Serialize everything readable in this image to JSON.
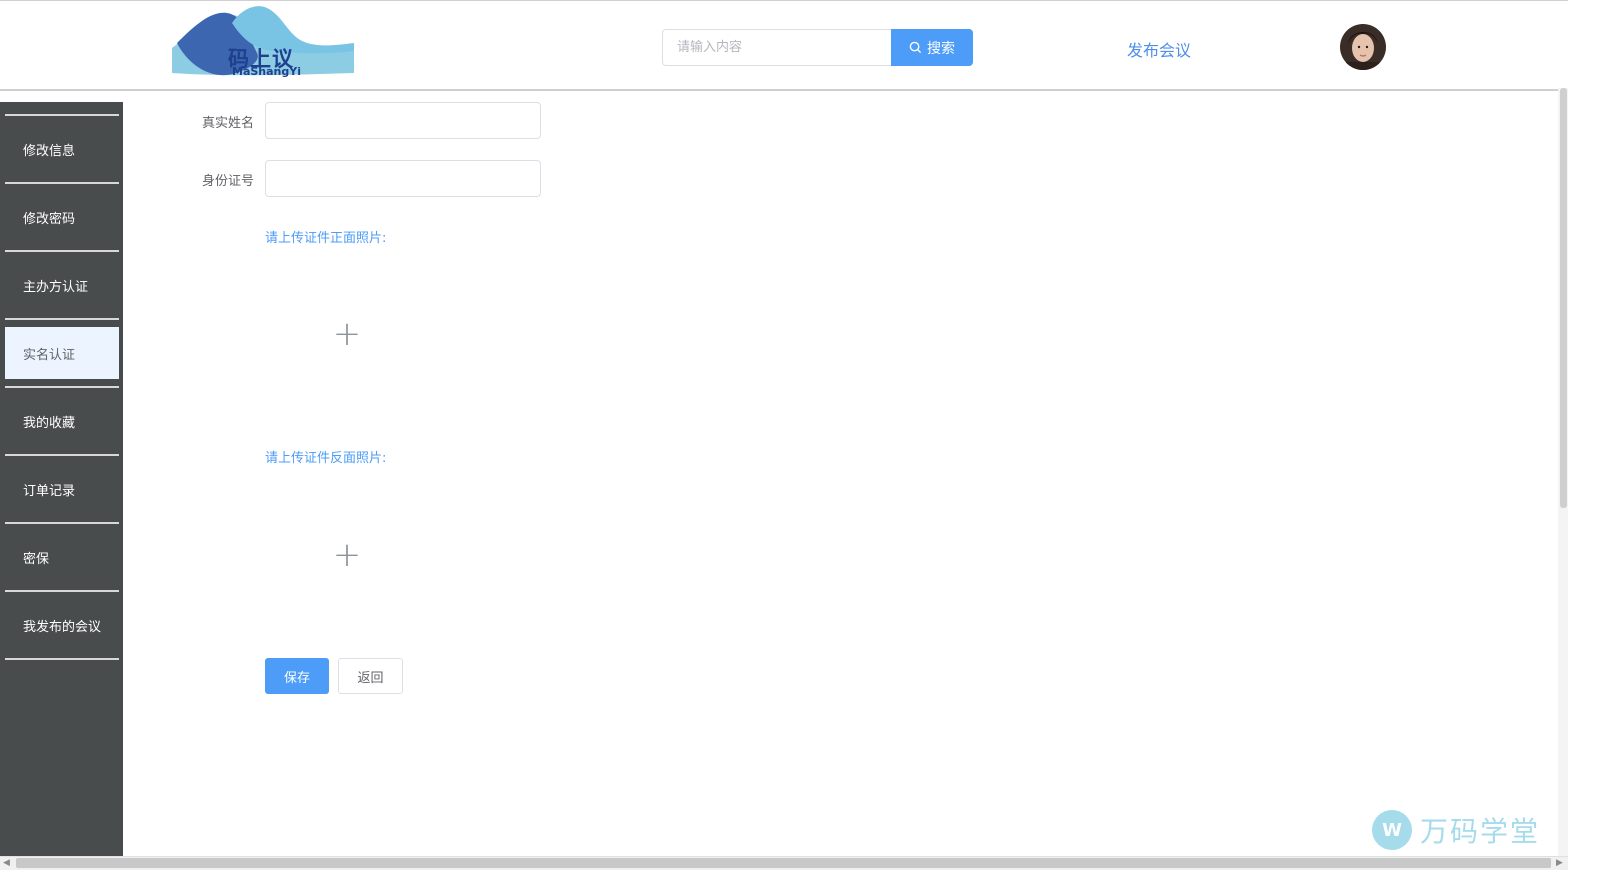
{
  "header": {
    "logo_text": "码上议",
    "logo_subtext": "MaShangYi",
    "search_placeholder": "请输入内容",
    "search_button_label": "搜索",
    "publish_link_label": "发布会议"
  },
  "sidebar": {
    "items": [
      {
        "label": "修改信息",
        "active": false
      },
      {
        "label": "修改密码",
        "active": false
      },
      {
        "label": "主办方认证",
        "active": false
      },
      {
        "label": "实名认证",
        "active": true
      },
      {
        "label": "我的收藏",
        "active": false
      },
      {
        "label": "订单记录",
        "active": false
      },
      {
        "label": "密保",
        "active": false
      },
      {
        "label": "我发布的会议",
        "active": false
      }
    ]
  },
  "form": {
    "real_name_label": "真实姓名",
    "real_name_value": "",
    "id_number_label": "身份证号",
    "id_number_value": "",
    "front_upload_label": "请上传证件正面照片:",
    "back_upload_label": "请上传证件反面照片:",
    "save_label": "保存",
    "back_label": "返回"
  },
  "watermark": {
    "text": "万码学堂"
  },
  "colors": {
    "primary": "#4d9cf8",
    "sidebar_bg": "#484c4d",
    "active_item_bg": "#ecf5ff"
  }
}
